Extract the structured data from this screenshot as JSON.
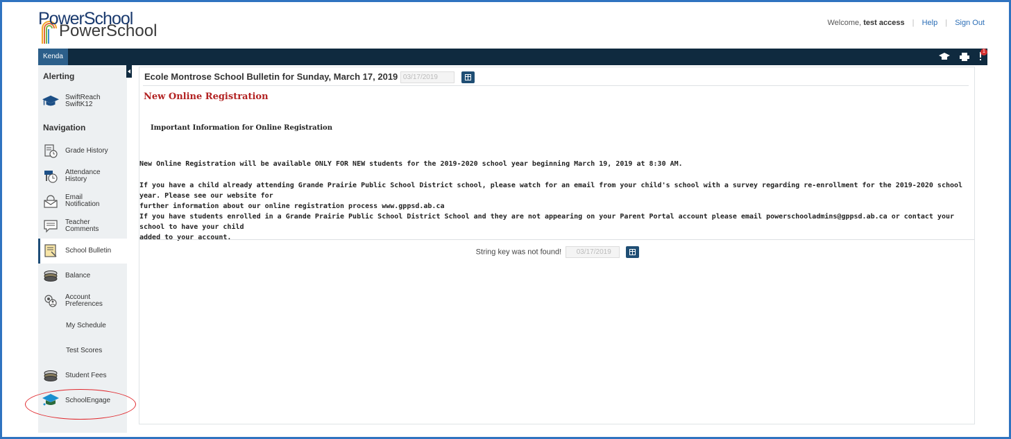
{
  "header": {
    "logo_top": "PowerSchool",
    "logo_bottom": "PowerSchool",
    "welcome_prefix": "Welcome,",
    "user_name": "test access",
    "help_link": "Help",
    "signout_link": "Sign Out"
  },
  "navbar": {
    "student_tab": "Kenda",
    "icons": [
      "graduation-cap-icon",
      "printer-icon",
      "alert-icon"
    ],
    "alert_count": "1"
  },
  "sidebar": {
    "alerting_heading": "Alerting",
    "swift_line1": "SwiftReach",
    "swift_line2": "SwiftK12",
    "navigation_heading": "Navigation",
    "items": [
      {
        "line1": "Grade History",
        "line2": ""
      },
      {
        "line1": "Attendance",
        "line2": "History"
      },
      {
        "line1": "Email",
        "line2": "Notification"
      },
      {
        "line1": "Teacher",
        "line2": "Comments"
      },
      {
        "line1": "School Bulletin",
        "line2": ""
      },
      {
        "line1": "Balance",
        "line2": ""
      },
      {
        "line1": "Account",
        "line2": "Preferences"
      },
      {
        "line1": "My Schedule",
        "line2": ""
      },
      {
        "line1": "Test Scores",
        "line2": ""
      },
      {
        "line1": "Student Fees",
        "line2": ""
      },
      {
        "line1": "SchoolEngage",
        "line2": ""
      }
    ],
    "active_item": "School Bulletin"
  },
  "main": {
    "bulletin_title": "Ecole Montrose School Bulletin for Sunday, March 17, 2019",
    "date_value": "03/17/2019",
    "registration_heading": "New Online Registration",
    "important_heading": "Important Information for Online Registration",
    "para1": "New Online Registration will be available ONLY FOR NEW students for the 2019-2020 school year beginning March 19, 2019 at 8:30 AM.",
    "para2_line1": "If you have a child already attending Grande Prairie Public School District school, please watch for an email from your child's school with a survey regarding re-enrollment for the 2019-2020 school year. Please see our website for",
    "para2_line2": "further information about our online registration process www.gppsd.ab.ca",
    "para3_line1": "If you have students enrolled in a Grande Prairie Public School District School and they are not appearing on your Parent Portal account please email powerschooladmins@gppsd.ab.ca or contact your school to have your child",
    "para3_line2": "added to your account.",
    "footer_label": "String key was not found!",
    "footer_date_value": "03/17/2019"
  },
  "colors": {
    "navbar": "#0f2a3f",
    "student_tab": "#2c5f8a",
    "heading_red": "#b22222",
    "frame_blue": "#2f73c0",
    "annotation_red": "#e0262b"
  }
}
